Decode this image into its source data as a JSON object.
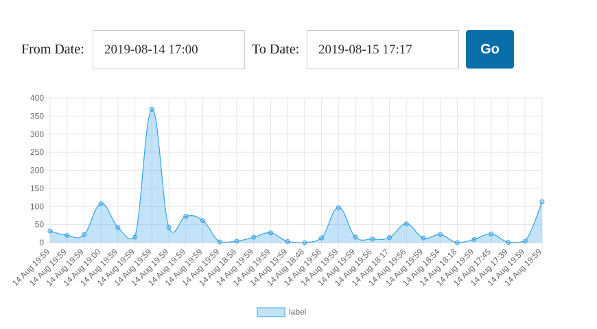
{
  "form": {
    "from_label": "From Date:",
    "from_value": "2019-08-14 17:00",
    "to_label": "To Date:",
    "to_value": "2019-08-15 17:17",
    "go_label": "Go"
  },
  "colors": {
    "line": "#36a2eb",
    "fill": "rgba(54,162,235,0.3)",
    "grid": "#e5e5e5",
    "button": "#0a6ea8"
  },
  "chart_data": {
    "type": "area",
    "ylim": [
      0,
      400
    ],
    "yticks": [
      0,
      50,
      100,
      150,
      200,
      250,
      300,
      350,
      400
    ],
    "grid": true,
    "legend_position": "bottom",
    "categories": [
      "14 Aug 19:59",
      "14 Aug 19:59",
      "14 Aug 19:59",
      "14 Aug 19:00",
      "14 Aug 19:59",
      "14 Aug 19:59",
      "14 Aug 19:59",
      "14 Aug 19:59",
      "14 Aug 19:59",
      "14 Aug 19:59",
      "14 Aug 19:59",
      "14 Aug 18:58",
      "14 Aug 19:59",
      "14 Aug 19:59",
      "14 Aug 19:59",
      "14 Aug 18:48",
      "14 Aug 19:58",
      "14 Aug 19:59",
      "14 Aug 19:59",
      "14 Aug 19:56",
      "14 Aug 18:17",
      "14 Aug 19:56",
      "14 Aug 19:59",
      "14 Aug 18:54",
      "14 Aug 18:18",
      "14 Aug 19:59",
      "14 Aug 17:45",
      "14 Aug 17:39",
      "14 Aug 19:59",
      "14 Aug 19:59"
    ],
    "series": [
      {
        "name": "label",
        "values": [
          32,
          20,
          22,
          108,
          42,
          15,
          369,
          42,
          73,
          61,
          2,
          4,
          15,
          27,
          3,
          0,
          13,
          97,
          15,
          10,
          14,
          52,
          13,
          22,
          0,
          9,
          24,
          1,
          4,
          113
        ]
      }
    ]
  }
}
